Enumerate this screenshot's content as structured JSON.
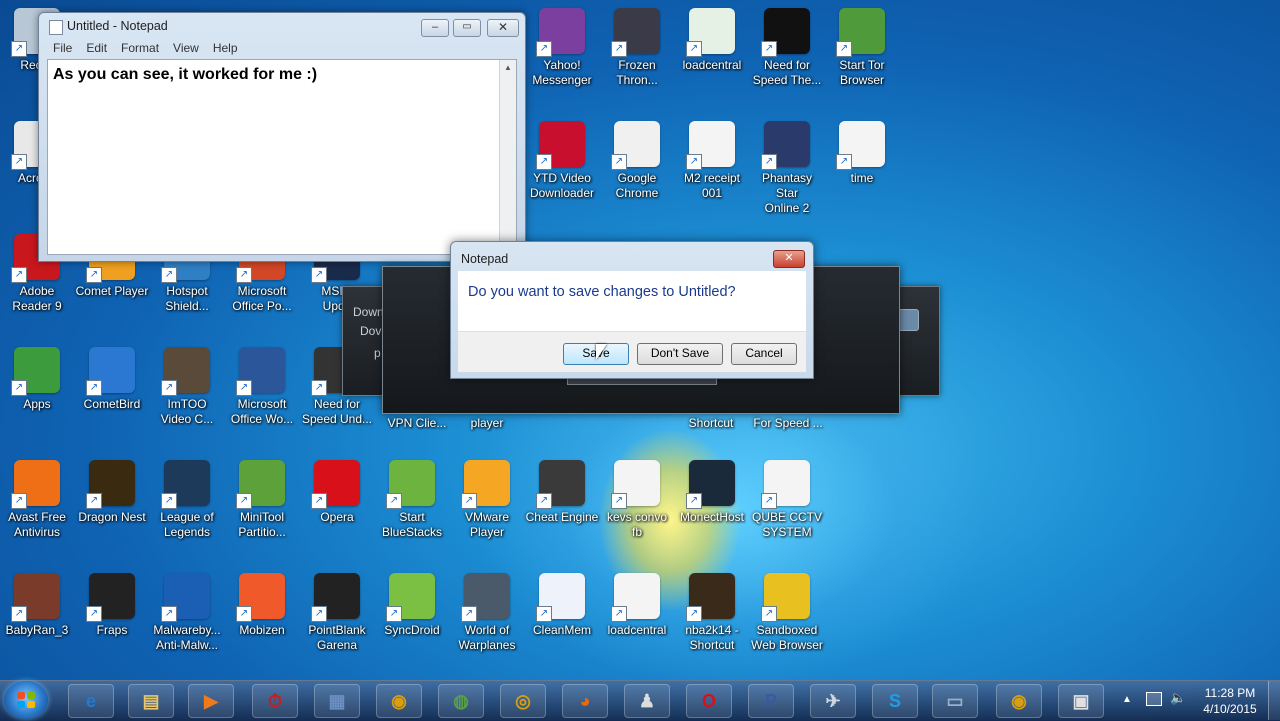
{
  "notepad": {
    "title": "Untitled - Notepad",
    "menu": [
      "File",
      "Edit",
      "Format",
      "View",
      "Help"
    ],
    "text": "As you can see, it worked for me :)"
  },
  "dialog": {
    "title": "Notepad",
    "message": "Do you want to save changes to Untitled?",
    "save_label": "Save",
    "dont_save_label": "Don't Save",
    "cancel_label": "Cancel"
  },
  "background_windows": {
    "dark_left_text": [
      "Down",
      "Dov",
      "p"
    ],
    "dark_bottom_labels": [
      "VPN Clie...",
      "player",
      "Shortcut",
      "For Speed ..."
    ]
  },
  "desktop_icons": [
    {
      "label": "Recyc",
      "color": "#b8c7d6",
      "name": "recycle-bin"
    },
    {
      "label": "Acroba",
      "color": "#e8e8e8",
      "name": "acrobat"
    },
    {
      "label": "Adobe\nReader 9",
      "color": "#c9171e",
      "name": "adobe-reader"
    },
    {
      "label": "Apps",
      "color": "#3c9b3c",
      "name": "apps"
    },
    {
      "label": "Avast Free\nAntivirus",
      "color": "#ef6f16",
      "name": "avast"
    },
    {
      "label": "BabyRan_3",
      "color": "#7a3b2a",
      "name": "babyran"
    },
    {
      "label": "Comet Player",
      "color": "#f0a020",
      "name": "comet-player"
    },
    {
      "label": "CometBird",
      "color": "#2a78d2",
      "name": "cometbird"
    },
    {
      "label": "Dragon Nest",
      "color": "#3a2a10",
      "name": "dragon-nest"
    },
    {
      "label": "Fraps",
      "color": "#222222",
      "name": "fraps"
    },
    {
      "label": "Hotspot\nShield...",
      "color": "#2f7fc4",
      "name": "hotspot-shield"
    },
    {
      "label": "ImTOO\nVideo C...",
      "color": "#5a4a3a",
      "name": "imtoo"
    },
    {
      "label": "League of\nLegends",
      "color": "#1e3a5a",
      "name": "league-of-legends"
    },
    {
      "label": "Malwareby...\nAnti-Malw...",
      "color": "#1a5fb4",
      "name": "malwarebytes"
    },
    {
      "label": "Microsoft\nOffice Po...",
      "color": "#d24726",
      "name": "office-powerpoint"
    },
    {
      "label": "Microsoft\nOffice Wo...",
      "color": "#2b579a",
      "name": "office-word"
    },
    {
      "label": "MiniTool\nPartitio...",
      "color": "#5da13a",
      "name": "minitool"
    },
    {
      "label": "Mobizen",
      "color": "#f05a2a",
      "name": "mobizen"
    },
    {
      "label": "MSI L\nUpda",
      "color": "#1a2a4a",
      "name": "msi-update"
    },
    {
      "label": "Need for\nSpeed Und...",
      "color": "#333333",
      "name": "nfs-underground"
    },
    {
      "label": "Opera",
      "color": "#d8101a",
      "name": "opera"
    },
    {
      "label": "PointBlank\nGarena",
      "color": "#222222",
      "name": "pointblank"
    },
    {
      "label": "Start\nBlueStacks",
      "color": "#6cb33f",
      "name": "bluestacks"
    },
    {
      "label": "SyncDroid",
      "color": "#7bc043",
      "name": "syncdroid"
    },
    {
      "label": "VMware\nPlayer",
      "color": "#f5a623",
      "name": "vmware"
    },
    {
      "label": "World of\nWarplanes",
      "color": "#4a5a6a",
      "name": "world-of-warplanes"
    },
    {
      "label": "Yahoo!\nMessenger",
      "color": "#7b3fa0",
      "name": "yahoo-messenger"
    },
    {
      "label": "YTD Video\nDownloader",
      "color": "#c8102e",
      "name": "ytd"
    },
    {
      "label": "Cheat Engine",
      "color": "#3a3a3a",
      "name": "cheat-engine"
    },
    {
      "label": "CleanMem",
      "color": "#eef3fb",
      "name": "cleanmem"
    },
    {
      "label": "Frozen\nThron...",
      "color": "#3a3a48",
      "name": "frozen-throne"
    },
    {
      "label": "Google\nChrome",
      "color": "#f0f0f0",
      "name": "chrome"
    },
    {
      "label": "kevs convo\nfb",
      "color": "#f4f4f4",
      "name": "kevs-convo"
    },
    {
      "label": "loadcentral",
      "color": "#f4f4f4",
      "name": "loadcentral-2"
    },
    {
      "label": "loadcentral",
      "color": "#e4f1e4",
      "name": "loadcentral"
    },
    {
      "label": "M2 receipt\n001",
      "color": "#f4f4f4",
      "name": "m2-receipt"
    },
    {
      "label": "MonectHost",
      "color": "#1a2a3a",
      "name": "monecthost"
    },
    {
      "label": "nba2k14 -\nShortcut",
      "color": "#3a2a1a",
      "name": "nba2k14"
    },
    {
      "label": "Need for\nSpeed The...",
      "color": "#111111",
      "name": "nfs-the-run"
    },
    {
      "label": "Phantasy Star\nOnline 2",
      "color": "#2a3a6a",
      "name": "pso2"
    },
    {
      "label": "QUBE CCTV\nSYSTEM",
      "color": "#f4f4f4",
      "name": "qube-cctv"
    },
    {
      "label": "Sandboxed\nWeb Browser",
      "color": "#e8c020",
      "name": "sandboxed-browser"
    },
    {
      "label": "Start Tor\nBrowser",
      "color": "#4f9a3a",
      "name": "tor-browser"
    },
    {
      "label": "time",
      "color": "#f4f4f4",
      "name": "time"
    }
  ],
  "taskbar": {
    "time": "11:28 PM",
    "date": "4/10/2015",
    "apps": [
      {
        "name": "ie",
        "glyph": "e",
        "color": "#1e7bd6"
      },
      {
        "name": "explorer",
        "glyph": "▤",
        "color": "#e8c46a"
      },
      {
        "name": "media-player",
        "glyph": "▶",
        "color": "#f07a1a"
      },
      {
        "name": "task-scheduler",
        "glyph": "⏱",
        "color": "#c81e1e"
      },
      {
        "name": "notepad-task",
        "glyph": "▦",
        "color": "#6a8fc0"
      },
      {
        "name": "chrome-task",
        "glyph": "◉",
        "color": "#d8a010"
      },
      {
        "name": "tor-task",
        "glyph": "◍",
        "color": "#58a048"
      },
      {
        "name": "ring-task",
        "glyph": "◎",
        "color": "#d8a010"
      },
      {
        "name": "firefox-task",
        "glyph": "◕",
        "color": "#e86a10"
      },
      {
        "name": "figure-task",
        "glyph": "♟",
        "color": "#dddddd"
      },
      {
        "name": "opera-task",
        "glyph": "O",
        "color": "#d8101a"
      },
      {
        "name": "pso-task",
        "glyph": "P",
        "color": "#3a5aa0"
      },
      {
        "name": "warplanes-task",
        "glyph": "✈",
        "color": "#cfd8e0"
      },
      {
        "name": "skype-task",
        "glyph": "S",
        "color": "#1aa0e8"
      },
      {
        "name": "notes-task",
        "glyph": "▭",
        "color": "#9ab0c8"
      },
      {
        "name": "chrome2-task",
        "glyph": "◉",
        "color": "#d8a010"
      },
      {
        "name": "folder-task",
        "glyph": "▣",
        "color": "#e0e0e0"
      }
    ]
  }
}
